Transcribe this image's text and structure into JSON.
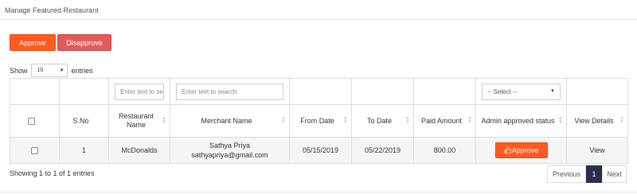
{
  "header": {
    "title": "Manage Featured Restaurant"
  },
  "toolbar": {
    "approve_label": "Approve",
    "disapprove_label": "Disapprove"
  },
  "length_menu": {
    "show_label": "Show",
    "selected": "10",
    "entries_label": "entries"
  },
  "filters": {
    "restaurant_placeholder": "Enter text to se",
    "merchant_placeholder": "Enter text to search",
    "status_select": "-- Select --"
  },
  "columns": [
    {
      "label": ""
    },
    {
      "label": "S.No"
    },
    {
      "label": "Restaurant Name"
    },
    {
      "label": "Merchant Name"
    },
    {
      "label": "From Date"
    },
    {
      "label": "To Date"
    },
    {
      "label": "Paid Amount"
    },
    {
      "label": "Admin approved status"
    },
    {
      "label": "View Details"
    }
  ],
  "rows": [
    {
      "sno": "1",
      "restaurant": "McDonalds",
      "merchant_name": "Sathya Priya",
      "merchant_email": "sathyapriya@gmail.com",
      "from_date": "05/15/2019",
      "to_date": "05/22/2019",
      "paid_amount": "800.00",
      "status_button": "Approve",
      "view_label": "View"
    }
  ],
  "info": "Showing 1 to 1 of 1 entries",
  "pagination": {
    "previous": "Previous",
    "current": "1",
    "next": "Next"
  },
  "colors": {
    "approve": "#ff5a1f",
    "disapprove": "#e15b5b",
    "active_page": "#2b2d4a"
  }
}
